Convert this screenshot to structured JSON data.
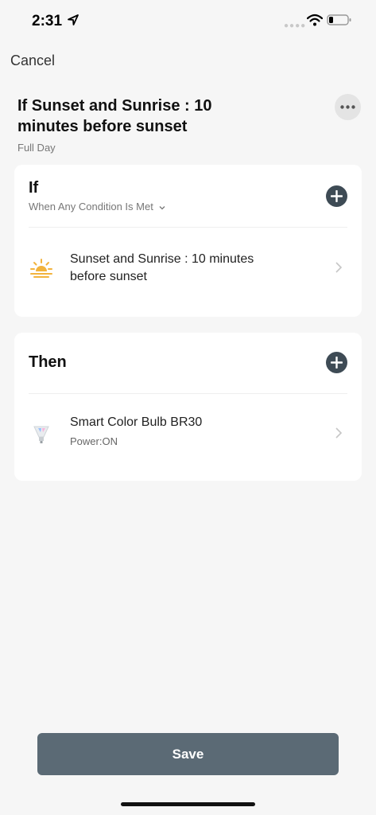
{
  "status_bar": {
    "time": "2:31",
    "icons": [
      "location-arrow-icon",
      "signal-dots-icon",
      "wifi-icon",
      "battery-icon"
    ]
  },
  "nav": {
    "cancel_label": "Cancel"
  },
  "header": {
    "title": "If  Sunset and Sunrise : 10 minutes before sunset",
    "subtitle": "Full Day",
    "more_icon": "ellipsis-icon"
  },
  "if_section": {
    "heading": "If",
    "condition_mode": "When Any Condition Is Met",
    "items": [
      {
        "icon": "sunset-icon",
        "title": "Sunset and Sunrise : 10 minutes before sunset"
      }
    ]
  },
  "then_section": {
    "heading": "Then",
    "items": [
      {
        "icon": "smart-bulb-icon",
        "title": "Smart Color Bulb BR30",
        "subtitle": "Power:ON"
      }
    ]
  },
  "footer": {
    "save_label": "Save"
  },
  "colors": {
    "background": "#f6f6f6",
    "card": "#ffffff",
    "add_button": "#3e4b55",
    "save_button": "#5b6a75",
    "sunset_accent": "#f2b33d"
  }
}
